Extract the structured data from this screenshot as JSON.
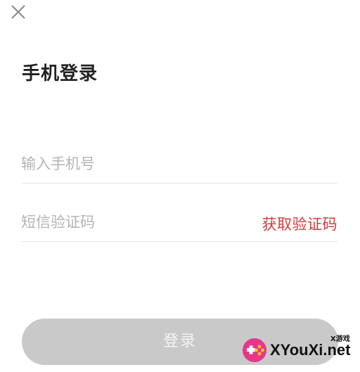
{
  "page": {
    "title": "手机登录"
  },
  "form": {
    "phone_placeholder": "输入手机号",
    "code_placeholder": "短信验证码",
    "get_code_label": "获取验证码",
    "login_label": "登录"
  },
  "watermark": {
    "small_text": "X游戏",
    "text": "XYouXi.net"
  },
  "icons": {
    "close": "close-icon",
    "logo": "gamepad-logo-icon"
  },
  "colors": {
    "accent": "#d63a3a",
    "button_disabled": "#c9c9c9",
    "placeholder": "#b4b4b4",
    "divider": "#e6e6e6"
  }
}
